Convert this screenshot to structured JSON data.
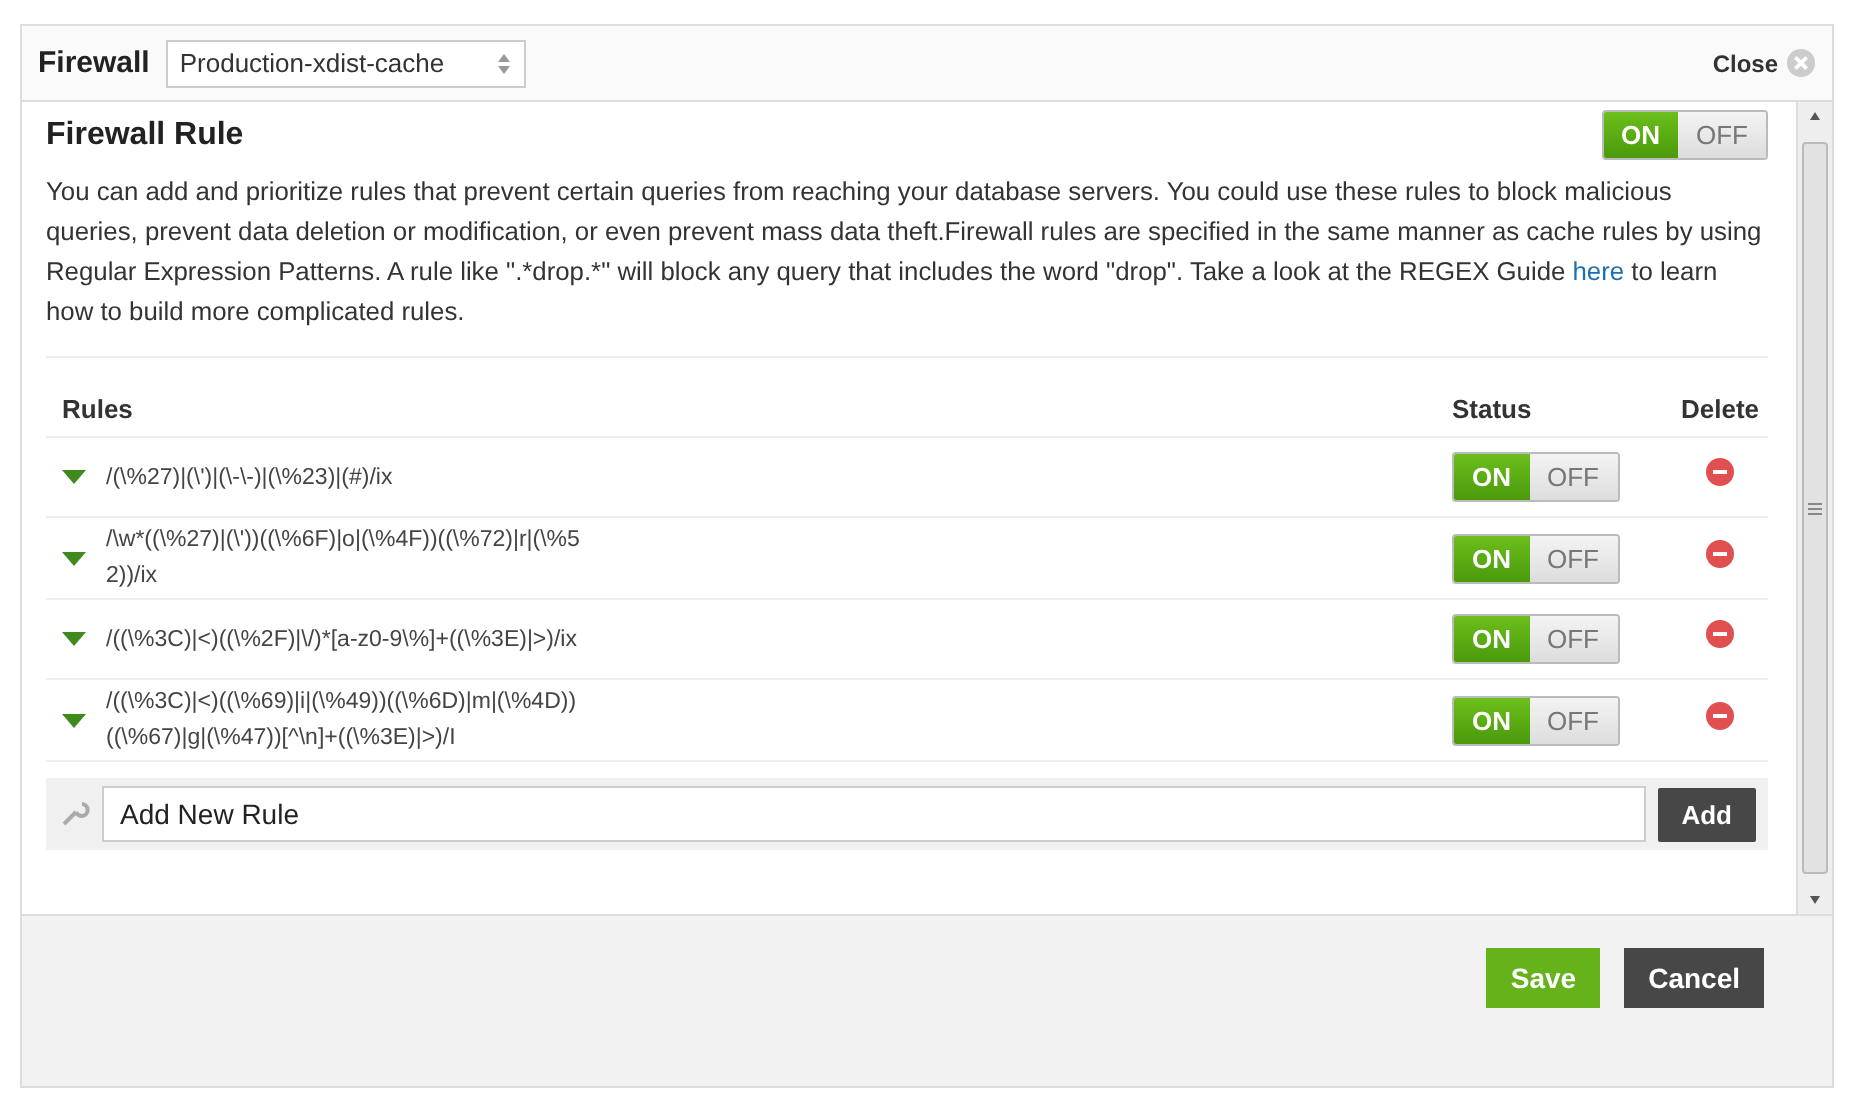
{
  "header": {
    "title": "Firewall",
    "select_value": "Production-xdist-cache",
    "close_label": "Close"
  },
  "section": {
    "title": "Firewall Rule",
    "toggle": {
      "on_label": "ON",
      "off_label": "OFF",
      "on": true
    },
    "description_before": "You can add and prioritize rules that prevent certain queries from reaching your database servers. You could use these rules to block malicious queries, prevent data deletion or modification, or even prevent mass data theft.Firewall rules are specified in the same manner as cache rules by using Regular Expression Patterns. A rule like \".*drop.*\" will block any query that includes the word \"drop\". Take a look at the REGEX Guide",
    "description_link": "here",
    "description_after": "to learn how to build more complicated rules."
  },
  "table": {
    "columns": [
      "Rules",
      "Status",
      "Delete"
    ],
    "rows": [
      {
        "rule": "/(\\%27)|(\\')|(\\-\\-)|(\\%23)|(#)/ix",
        "on_label": "ON",
        "off_label": "OFF",
        "on": true
      },
      {
        "rule": "/\\w*((\\%27)|(\\'))((\\%6F)|o|(\\%4F))((\\%72)|r|(\\%52))/ix",
        "on_label": "ON",
        "off_label": "OFF",
        "on": true
      },
      {
        "rule": "/((\\%3C)|<)((\\%2F)|\\/)*[a-z0-9\\%]+((\\%3E)|>)/ix",
        "on_label": "ON",
        "off_label": "OFF",
        "on": true
      },
      {
        "rule": "/((\\%3C)|<)((\\%69)|i|(\\%49))((\\%6D)|m|(\\%4D))((\\%67)|g|(\\%47))[^\\n]+((\\%3E)|>)/I",
        "on_label": "ON",
        "off_label": "OFF",
        "on": true
      }
    ]
  },
  "add_rule": {
    "placeholder": "Add New Rule",
    "button": "Add"
  },
  "buttons": [
    {
      "label": "Save",
      "kind": "primary"
    },
    {
      "label": "Cancel",
      "kind": "secondary"
    }
  ]
}
